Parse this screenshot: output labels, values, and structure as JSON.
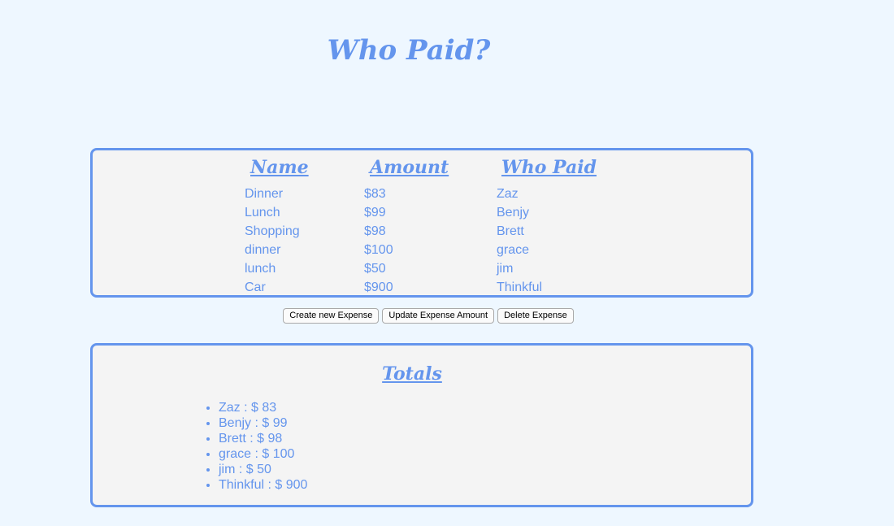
{
  "app": {
    "title": "Who Paid?"
  },
  "expenses": {
    "headers": {
      "name": "Name",
      "amount": "Amount",
      "who_paid": "Who Paid"
    },
    "rows": [
      {
        "name": "Dinner",
        "amount": "$83",
        "who_paid": "Zaz"
      },
      {
        "name": "Lunch",
        "amount": "$99",
        "who_paid": "Benjy"
      },
      {
        "name": "Shopping",
        "amount": "$98",
        "who_paid": "Brett"
      },
      {
        "name": "dinner",
        "amount": "$100",
        "who_paid": "grace"
      },
      {
        "name": "lunch",
        "amount": "$50",
        "who_paid": "jim"
      },
      {
        "name": "Car",
        "amount": "$900",
        "who_paid": "Thinkful"
      }
    ]
  },
  "actions": {
    "create_label": "Create new Expense",
    "update_label": "Update Expense Amount",
    "delete_label": "Delete Expense"
  },
  "totals": {
    "title": "Totals",
    "items": [
      "Zaz : $ 83",
      "Benjy : $ 99",
      "Brett : $ 98",
      "grace : $ 100",
      "jim : $ 50",
      "Thinkful : $ 900"
    ]
  },
  "colors": {
    "accent": "#6495ed",
    "page_background": "#eef7ff",
    "panel_background": "#f4f4f4"
  }
}
